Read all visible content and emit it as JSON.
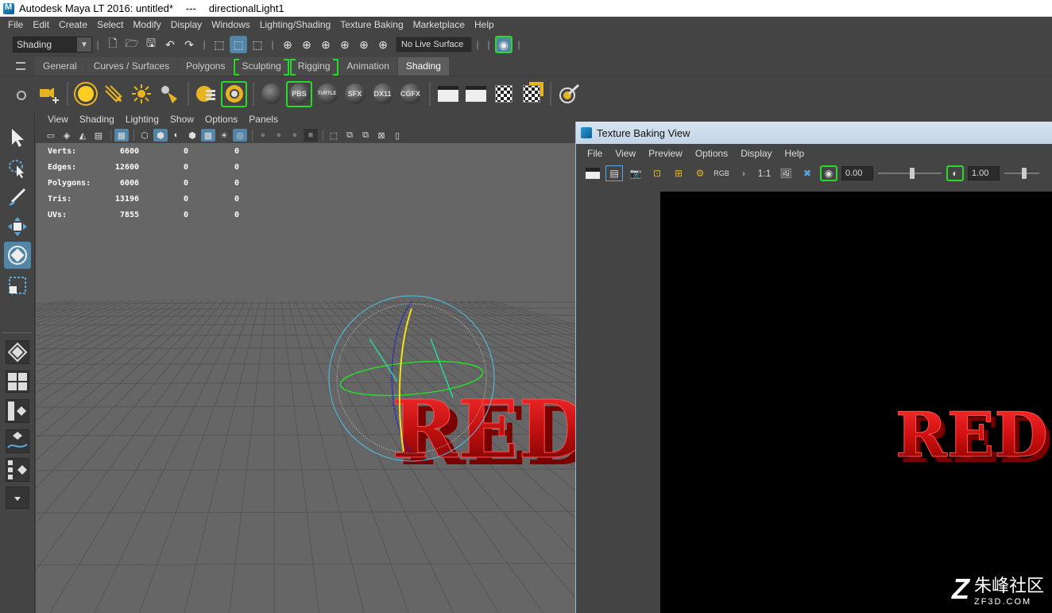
{
  "window": {
    "app_title": "Autodesk Maya LT 2016: untitled*",
    "separator": "---",
    "selection": "directionalLight1"
  },
  "main_menu": [
    "File",
    "Edit",
    "Create",
    "Select",
    "Modify",
    "Display",
    "Windows",
    "Lighting/Shading",
    "Texture Baking",
    "Marketplace",
    "Help"
  ],
  "status_line": {
    "menu_set": "Shading",
    "live_surface": "No Live Surface"
  },
  "shelf_tabs": [
    "General",
    "Curves / Surfaces",
    "Polygons",
    "Sculpting",
    "Rigging",
    "Animation",
    "Shading"
  ],
  "shelf_active_tab": "Shading",
  "shelf_labels": {
    "pbs": "PBS",
    "turtle": "TURTLE",
    "sfx": "SFX",
    "dx11": "DX11",
    "cgfx": "CGFX"
  },
  "panel_menu": [
    "View",
    "Shading",
    "Lighting",
    "Show",
    "Options",
    "Panels"
  ],
  "hud": [
    {
      "label": "Verts:",
      "v1": "6600",
      "v2": "0",
      "v3": "0"
    },
    {
      "label": "Edges:",
      "v1": "12600",
      "v2": "0",
      "v3": "0"
    },
    {
      "label": "Polygons:",
      "v1": "6006",
      "v2": "0",
      "v3": "0"
    },
    {
      "label": "Tris:",
      "v1": "13196",
      "v2": "0",
      "v3": "0"
    },
    {
      "label": "UVs:",
      "v1": "7855",
      "v2": "0",
      "v3": "0"
    }
  ],
  "model_text": "RED",
  "texture_baking": {
    "title": "Texture Baking View",
    "menu": [
      "File",
      "View",
      "Preview",
      "Options",
      "Display",
      "Help"
    ],
    "rgb_label": "RGB",
    "ratio_label": "1:1",
    "exposure": "0.00",
    "gamma": "1.00",
    "exposure_level": 0.5,
    "gamma_level": 0.5
  },
  "watermark": {
    "logo": "Z",
    "name": "朱峰社区",
    "url": "ZF3D.COM"
  },
  "colors": {
    "accent_blue": "#5285a6",
    "bracket_green": "#2dd82d",
    "model_red": "#cc1111"
  }
}
